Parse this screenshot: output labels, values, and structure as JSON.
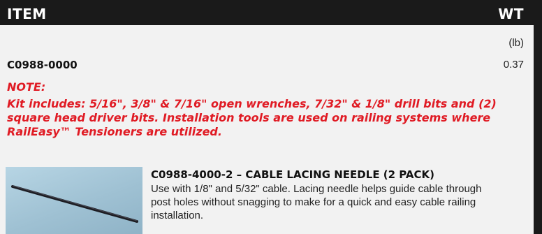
{
  "table": {
    "col_item": "ITEM",
    "col_wt": "WT",
    "unit": "(lb)",
    "rows": [
      {
        "code": "C0988-0000",
        "weight": "0.37"
      }
    ]
  },
  "note": {
    "title": "NOTE:",
    "body": "Kit includes: 5/16\", 3/8\" & 7/16\" open wrenches, 7/32\" & 1/8\" drill bits and (2) square head driver bits. Installation tools are used on railing systems where RailEasy™ Tensioners are utilized."
  },
  "product": {
    "title": "C0988-4000-2 – CABLE LACING NEEDLE (2 PACK)",
    "description": "Use with 1/8\" and 5/32\" cable. Lacing needle helps guide cable through post holes without snagging to make for a quick and easy cable railing installation."
  },
  "colors": {
    "header_bg": "#1a1a1a",
    "note_red": "#e01b24",
    "page_bg": "#f2f2f2"
  }
}
